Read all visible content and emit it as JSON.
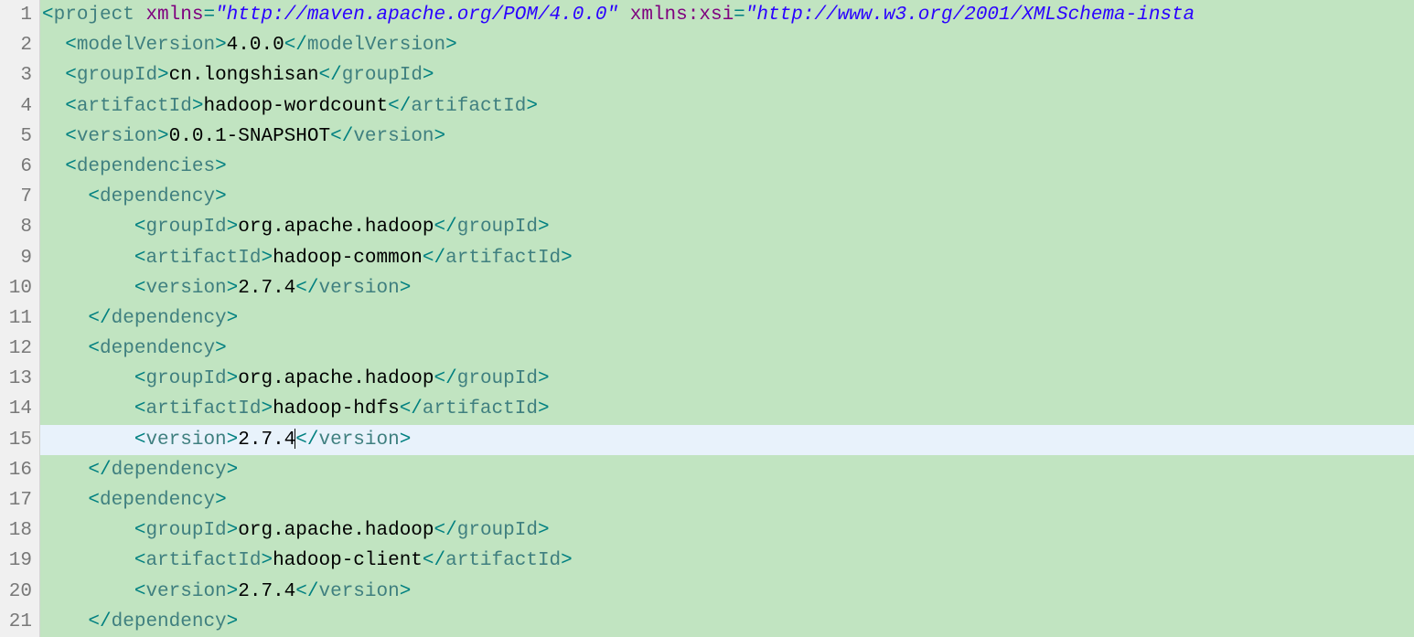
{
  "lines": [
    {
      "num": "1",
      "fold": true
    },
    {
      "num": "2"
    },
    {
      "num": "3"
    },
    {
      "num": "4"
    },
    {
      "num": "5"
    },
    {
      "num": "6",
      "fold": true
    },
    {
      "num": "7",
      "fold": true
    },
    {
      "num": "8"
    },
    {
      "num": "9"
    },
    {
      "num": "10"
    },
    {
      "num": "11"
    },
    {
      "num": "12",
      "fold": true
    },
    {
      "num": "13"
    },
    {
      "num": "14"
    },
    {
      "num": "15",
      "current": true
    },
    {
      "num": "16"
    },
    {
      "num": "17",
      "fold": true
    },
    {
      "num": "18"
    },
    {
      "num": "19"
    },
    {
      "num": "20"
    },
    {
      "num": "21"
    }
  ],
  "code": {
    "l1": {
      "t1": "<",
      "t2": "project",
      "t3": " ",
      "t4": "xmlns",
      "t5": "=",
      "t6": "\"http://maven.apache.org/POM/4.0.0\"",
      "t7": " ",
      "t8": "xmlns:xsi",
      "t9": "=",
      "t10": "\"http://www.w3.org/2001/XMLSchema-insta"
    },
    "l2": {
      "indent": "  ",
      "t1": "<",
      "t2": "modelVersion",
      "t3": ">",
      "t4": "4.0.0",
      "t5": "</",
      "t6": "modelVersion",
      "t7": ">"
    },
    "l3": {
      "indent": "  ",
      "t1": "<",
      "t2": "groupId",
      "t3": ">",
      "t4": "cn.longshisan",
      "t5": "</",
      "t6": "groupId",
      "t7": ">"
    },
    "l4": {
      "indent": "  ",
      "t1": "<",
      "t2": "artifactId",
      "t3": ">",
      "t4": "hadoop-wordcount",
      "t5": "</",
      "t6": "artifactId",
      "t7": ">"
    },
    "l5": {
      "indent": "  ",
      "t1": "<",
      "t2": "version",
      "t3": ">",
      "t4": "0.0.1-SNAPSHOT",
      "t5": "</",
      "t6": "version",
      "t7": ">"
    },
    "l6": {
      "indent": "  ",
      "t1": "<",
      "t2": "dependencies",
      "t3": ">"
    },
    "l7": {
      "indent": "    ",
      "t1": "<",
      "t2": "dependency",
      "t3": ">"
    },
    "l8": {
      "indent": "        ",
      "t1": "<",
      "t2": "groupId",
      "t3": ">",
      "t4": "org.apache.hadoop",
      "t5": "</",
      "t6": "groupId",
      "t7": ">"
    },
    "l9": {
      "indent": "        ",
      "t1": "<",
      "t2": "artifactId",
      "t3": ">",
      "t4": "hadoop-common",
      "t5": "</",
      "t6": "artifactId",
      "t7": ">"
    },
    "l10": {
      "indent": "        ",
      "t1": "<",
      "t2": "version",
      "t3": ">",
      "t4": "2.7.4",
      "t5": "</",
      "t6": "version",
      "t7": ">"
    },
    "l11": {
      "indent": "    ",
      "t1": "</",
      "t2": "dependency",
      "t3": ">"
    },
    "l12": {
      "indent": "    ",
      "t1": "<",
      "t2": "dependency",
      "t3": ">"
    },
    "l13": {
      "indent": "        ",
      "t1": "<",
      "t2": "groupId",
      "t3": ">",
      "t4": "org.apache.hadoop",
      "t5": "</",
      "t6": "groupId",
      "t7": ">"
    },
    "l14": {
      "indent": "        ",
      "t1": "<",
      "t2": "artifactId",
      "t3": ">",
      "t4": "hadoop-hdfs",
      "t5": "</",
      "t6": "artifactId",
      "t7": ">"
    },
    "l15": {
      "indent": "        ",
      "t1": "<",
      "t2": "version",
      "t3": ">",
      "t4": "2.7.4",
      "t5": "</",
      "t6": "version",
      "t7": ">"
    },
    "l16": {
      "indent": "    ",
      "t1": "</",
      "t2": "dependency",
      "t3": ">"
    },
    "l17": {
      "indent": "    ",
      "t1": "<",
      "t2": "dependency",
      "t3": ">"
    },
    "l18": {
      "indent": "        ",
      "t1": "<",
      "t2": "groupId",
      "t3": ">",
      "t4": "org.apache.hadoop",
      "t5": "</",
      "t6": "groupId",
      "t7": ">"
    },
    "l19": {
      "indent": "        ",
      "t1": "<",
      "t2": "artifactId",
      "t3": ">",
      "t4": "hadoop-client",
      "t5": "</",
      "t6": "artifactId",
      "t7": ">"
    },
    "l20": {
      "indent": "        ",
      "t1": "<",
      "t2": "version",
      "t3": ">",
      "t4": "2.7.4",
      "t5": "</",
      "t6": "version",
      "t7": ">"
    },
    "l21": {
      "indent": "    ",
      "t1": "</",
      "t2": "dependency",
      "t3": ">"
    }
  }
}
